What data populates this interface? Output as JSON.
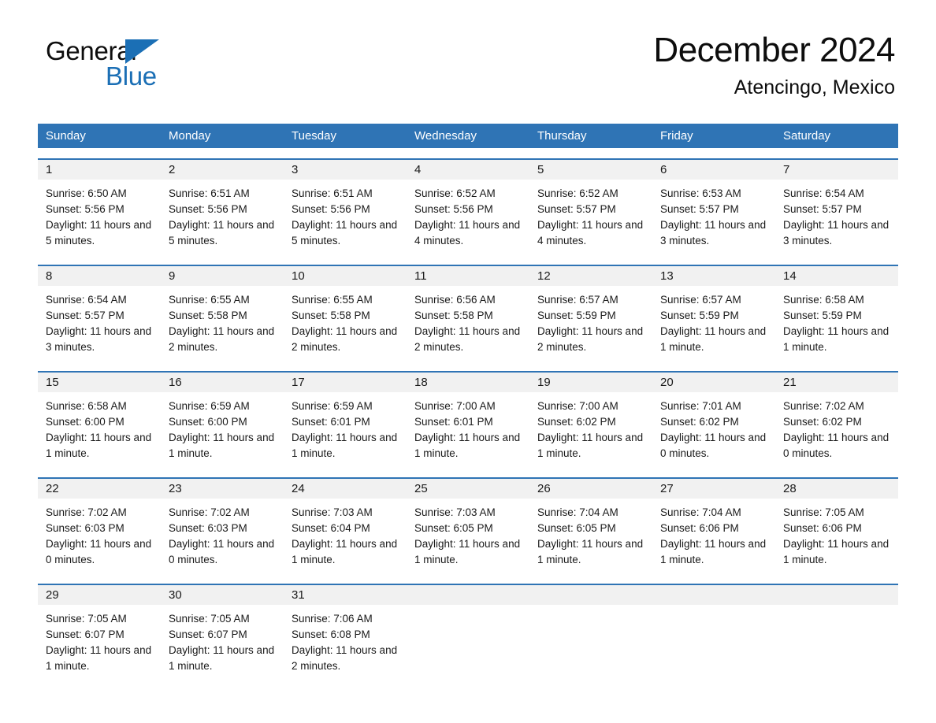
{
  "brand": {
    "name_part1": "General",
    "name_part2": "Blue",
    "logo_icon": "triangle-logo-icon",
    "accent_color": "#1b6fb5"
  },
  "header": {
    "month_title": "December 2024",
    "location": "Atencingo, Mexico"
  },
  "calendar": {
    "header_bg_color": "#2f74b5",
    "daynum_bg_color": "#f1f1f1",
    "weekdays": [
      "Sunday",
      "Monday",
      "Tuesday",
      "Wednesday",
      "Thursday",
      "Friday",
      "Saturday"
    ],
    "weeks": [
      [
        {
          "day": "1",
          "sunrise": "Sunrise: 6:50 AM",
          "sunset": "Sunset: 5:56 PM",
          "daylight": "Daylight: 11 hours and 5 minutes."
        },
        {
          "day": "2",
          "sunrise": "Sunrise: 6:51 AM",
          "sunset": "Sunset: 5:56 PM",
          "daylight": "Daylight: 11 hours and 5 minutes."
        },
        {
          "day": "3",
          "sunrise": "Sunrise: 6:51 AM",
          "sunset": "Sunset: 5:56 PM",
          "daylight": "Daylight: 11 hours and 5 minutes."
        },
        {
          "day": "4",
          "sunrise": "Sunrise: 6:52 AM",
          "sunset": "Sunset: 5:56 PM",
          "daylight": "Daylight: 11 hours and 4 minutes."
        },
        {
          "day": "5",
          "sunrise": "Sunrise: 6:52 AM",
          "sunset": "Sunset: 5:57 PM",
          "daylight": "Daylight: 11 hours and 4 minutes."
        },
        {
          "day": "6",
          "sunrise": "Sunrise: 6:53 AM",
          "sunset": "Sunset: 5:57 PM",
          "daylight": "Daylight: 11 hours and 3 minutes."
        },
        {
          "day": "7",
          "sunrise": "Sunrise: 6:54 AM",
          "sunset": "Sunset: 5:57 PM",
          "daylight": "Daylight: 11 hours and 3 minutes."
        }
      ],
      [
        {
          "day": "8",
          "sunrise": "Sunrise: 6:54 AM",
          "sunset": "Sunset: 5:57 PM",
          "daylight": "Daylight: 11 hours and 3 minutes."
        },
        {
          "day": "9",
          "sunrise": "Sunrise: 6:55 AM",
          "sunset": "Sunset: 5:58 PM",
          "daylight": "Daylight: 11 hours and 2 minutes."
        },
        {
          "day": "10",
          "sunrise": "Sunrise: 6:55 AM",
          "sunset": "Sunset: 5:58 PM",
          "daylight": "Daylight: 11 hours and 2 minutes."
        },
        {
          "day": "11",
          "sunrise": "Sunrise: 6:56 AM",
          "sunset": "Sunset: 5:58 PM",
          "daylight": "Daylight: 11 hours and 2 minutes."
        },
        {
          "day": "12",
          "sunrise": "Sunrise: 6:57 AM",
          "sunset": "Sunset: 5:59 PM",
          "daylight": "Daylight: 11 hours and 2 minutes."
        },
        {
          "day": "13",
          "sunrise": "Sunrise: 6:57 AM",
          "sunset": "Sunset: 5:59 PM",
          "daylight": "Daylight: 11 hours and 1 minute."
        },
        {
          "day": "14",
          "sunrise": "Sunrise: 6:58 AM",
          "sunset": "Sunset: 5:59 PM",
          "daylight": "Daylight: 11 hours and 1 minute."
        }
      ],
      [
        {
          "day": "15",
          "sunrise": "Sunrise: 6:58 AM",
          "sunset": "Sunset: 6:00 PM",
          "daylight": "Daylight: 11 hours and 1 minute."
        },
        {
          "day": "16",
          "sunrise": "Sunrise: 6:59 AM",
          "sunset": "Sunset: 6:00 PM",
          "daylight": "Daylight: 11 hours and 1 minute."
        },
        {
          "day": "17",
          "sunrise": "Sunrise: 6:59 AM",
          "sunset": "Sunset: 6:01 PM",
          "daylight": "Daylight: 11 hours and 1 minute."
        },
        {
          "day": "18",
          "sunrise": "Sunrise: 7:00 AM",
          "sunset": "Sunset: 6:01 PM",
          "daylight": "Daylight: 11 hours and 1 minute."
        },
        {
          "day": "19",
          "sunrise": "Sunrise: 7:00 AM",
          "sunset": "Sunset: 6:02 PM",
          "daylight": "Daylight: 11 hours and 1 minute."
        },
        {
          "day": "20",
          "sunrise": "Sunrise: 7:01 AM",
          "sunset": "Sunset: 6:02 PM",
          "daylight": "Daylight: 11 hours and 0 minutes."
        },
        {
          "day": "21",
          "sunrise": "Sunrise: 7:02 AM",
          "sunset": "Sunset: 6:02 PM",
          "daylight": "Daylight: 11 hours and 0 minutes."
        }
      ],
      [
        {
          "day": "22",
          "sunrise": "Sunrise: 7:02 AM",
          "sunset": "Sunset: 6:03 PM",
          "daylight": "Daylight: 11 hours and 0 minutes."
        },
        {
          "day": "23",
          "sunrise": "Sunrise: 7:02 AM",
          "sunset": "Sunset: 6:03 PM",
          "daylight": "Daylight: 11 hours and 0 minutes."
        },
        {
          "day": "24",
          "sunrise": "Sunrise: 7:03 AM",
          "sunset": "Sunset: 6:04 PM",
          "daylight": "Daylight: 11 hours and 1 minute."
        },
        {
          "day": "25",
          "sunrise": "Sunrise: 7:03 AM",
          "sunset": "Sunset: 6:05 PM",
          "daylight": "Daylight: 11 hours and 1 minute."
        },
        {
          "day": "26",
          "sunrise": "Sunrise: 7:04 AM",
          "sunset": "Sunset: 6:05 PM",
          "daylight": "Daylight: 11 hours and 1 minute."
        },
        {
          "day": "27",
          "sunrise": "Sunrise: 7:04 AM",
          "sunset": "Sunset: 6:06 PM",
          "daylight": "Daylight: 11 hours and 1 minute."
        },
        {
          "day": "28",
          "sunrise": "Sunrise: 7:05 AM",
          "sunset": "Sunset: 6:06 PM",
          "daylight": "Daylight: 11 hours and 1 minute."
        }
      ],
      [
        {
          "day": "29",
          "sunrise": "Sunrise: 7:05 AM",
          "sunset": "Sunset: 6:07 PM",
          "daylight": "Daylight: 11 hours and 1 minute."
        },
        {
          "day": "30",
          "sunrise": "Sunrise: 7:05 AM",
          "sunset": "Sunset: 6:07 PM",
          "daylight": "Daylight: 11 hours and 1 minute."
        },
        {
          "day": "31",
          "sunrise": "Sunrise: 7:06 AM",
          "sunset": "Sunset: 6:08 PM",
          "daylight": "Daylight: 11 hours and 2 minutes."
        },
        {
          "day": "",
          "sunrise": "",
          "sunset": "",
          "daylight": ""
        },
        {
          "day": "",
          "sunrise": "",
          "sunset": "",
          "daylight": ""
        },
        {
          "day": "",
          "sunrise": "",
          "sunset": "",
          "daylight": ""
        },
        {
          "day": "",
          "sunrise": "",
          "sunset": "",
          "daylight": ""
        }
      ]
    ]
  }
}
